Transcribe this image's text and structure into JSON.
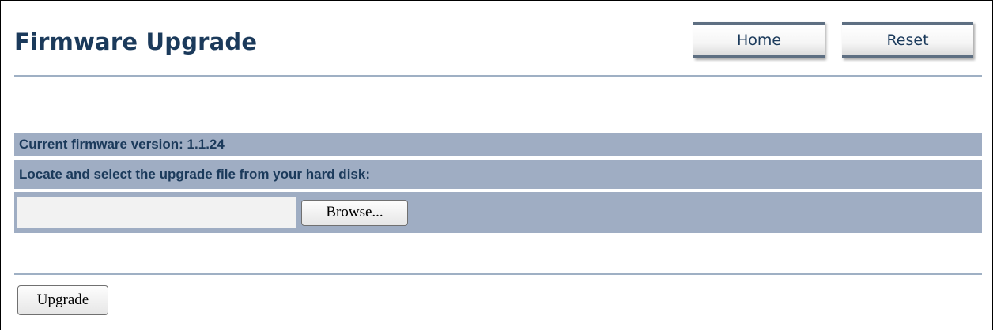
{
  "header": {
    "title": "Firmware Upgrade",
    "home_label": "Home",
    "reset_label": "Reset"
  },
  "firmware": {
    "current_version_text": "Current firmware version: 1.1.24",
    "locate_text": "Locate and select the upgrade file from your hard disk:",
    "file_value": "",
    "browse_label": "Browse..."
  },
  "actions": {
    "upgrade_label": "Upgrade"
  },
  "colors": {
    "title": "#1b3a5b",
    "row_background": "#9fadc3",
    "divider": "#9fb0c4",
    "button_border": "#5e6f82"
  }
}
